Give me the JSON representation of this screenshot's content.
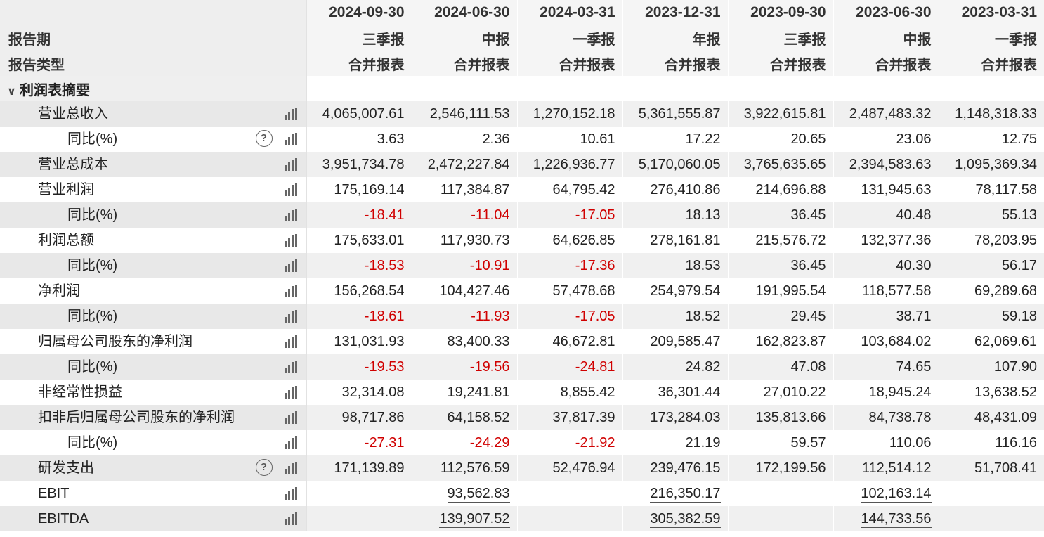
{
  "header": {
    "dates": [
      "2024-09-30",
      "2024-06-30",
      "2024-03-31",
      "2023-12-31",
      "2023-09-30",
      "2023-06-30",
      "2023-03-31"
    ],
    "report_period_label": "报告期",
    "report_period": [
      "三季报",
      "中报",
      "一季报",
      "年报",
      "三季报",
      "中报",
      "一季报"
    ],
    "report_type_label": "报告类型",
    "report_type": [
      "合并报表",
      "合并报表",
      "合并报表",
      "合并报表",
      "合并报表",
      "合并报表",
      "合并报表"
    ]
  },
  "section": {
    "title": "利润表摘要",
    "icon": "chevron-down-icon"
  },
  "rows": [
    {
      "label": "营业总收入",
      "level": 1,
      "help": false,
      "values": [
        "4,065,007.61",
        "2,546,111.53",
        "1,270,152.18",
        "5,361,555.87",
        "3,922,615.81",
        "2,487,483.32",
        "1,148,318.33"
      ]
    },
    {
      "label": "同比(%)",
      "level": 2,
      "help": true,
      "values": [
        "3.63",
        "2.36",
        "10.61",
        "17.22",
        "20.65",
        "23.06",
        "12.75"
      ]
    },
    {
      "label": "营业总成本",
      "level": 1,
      "help": false,
      "values": [
        "3,951,734.78",
        "2,472,227.84",
        "1,226,936.77",
        "5,170,060.05",
        "3,765,635.65",
        "2,394,583.63",
        "1,095,369.34"
      ]
    },
    {
      "label": "营业利润",
      "level": 1,
      "help": false,
      "values": [
        "175,169.14",
        "117,384.87",
        "64,795.42",
        "276,410.86",
        "214,696.88",
        "131,945.63",
        "78,117.58"
      ]
    },
    {
      "label": "同比(%)",
      "level": 2,
      "help": false,
      "values": [
        "-18.41",
        "-11.04",
        "-17.05",
        "18.13",
        "36.45",
        "40.48",
        "55.13"
      ]
    },
    {
      "label": "利润总额",
      "level": 1,
      "help": false,
      "values": [
        "175,633.01",
        "117,930.73",
        "64,626.85",
        "278,161.81",
        "215,576.72",
        "132,377.36",
        "78,203.95"
      ]
    },
    {
      "label": "同比(%)",
      "level": 2,
      "help": false,
      "values": [
        "-18.53",
        "-10.91",
        "-17.36",
        "18.53",
        "36.45",
        "40.30",
        "56.17"
      ]
    },
    {
      "label": "净利润",
      "level": 1,
      "help": false,
      "values": [
        "156,268.54",
        "104,427.46",
        "57,478.68",
        "254,979.54",
        "191,995.54",
        "118,577.58",
        "69,289.68"
      ]
    },
    {
      "label": "同比(%)",
      "level": 2,
      "help": false,
      "values": [
        "-18.61",
        "-11.93",
        "-17.05",
        "18.52",
        "29.45",
        "38.71",
        "59.18"
      ]
    },
    {
      "label": "归属母公司股东的净利润",
      "level": 1,
      "help": false,
      "values": [
        "131,031.93",
        "83,400.33",
        "46,672.81",
        "209,585.47",
        "162,823.87",
        "103,684.02",
        "62,069.61"
      ]
    },
    {
      "label": "同比(%)",
      "level": 2,
      "help": false,
      "values": [
        "-19.53",
        "-19.56",
        "-24.81",
        "24.82",
        "47.08",
        "74.65",
        "107.90"
      ]
    },
    {
      "label": "非经常性损益",
      "level": 1,
      "help": false,
      "values": [
        "32,314.08",
        "19,241.81",
        "8,855.42",
        "36,301.44",
        "27,010.22",
        "18,945.24",
        "13,638.52"
      ]
    },
    {
      "label": "扣非后归属母公司股东的净利润",
      "level": 1,
      "help": false,
      "values": [
        "98,717.86",
        "64,158.52",
        "37,817.39",
        "173,284.03",
        "135,813.66",
        "84,738.78",
        "48,431.09"
      ]
    },
    {
      "label": "同比(%)",
      "level": 2,
      "help": false,
      "values": [
        "-27.31",
        "-24.29",
        "-21.92",
        "21.19",
        "59.57",
        "110.06",
        "116.16"
      ]
    },
    {
      "label": "研发支出",
      "level": 1,
      "help": true,
      "values": [
        "171,139.89",
        "112,576.59",
        "52,476.94",
        "239,476.15",
        "172,199.56",
        "112,514.12",
        "51,708.41"
      ]
    },
    {
      "label": "EBIT",
      "level": 1,
      "help": false,
      "values": [
        "",
        "93,562.83",
        "",
        "216,350.17",
        "",
        "102,163.14",
        ""
      ]
    },
    {
      "label": "EBITDA",
      "level": 1,
      "help": false,
      "values": [
        "",
        "139,907.52",
        "",
        "305,382.59",
        "",
        "144,733.56",
        ""
      ]
    }
  ],
  "colors": {
    "negative": "#d00000",
    "row_shade": "#f0f0f0",
    "label_shade": "#e8e8e8",
    "header_bg": "#f5f5f5"
  },
  "icons": {
    "row_chart": "bar-chart-icon",
    "row_help": "help-icon"
  }
}
